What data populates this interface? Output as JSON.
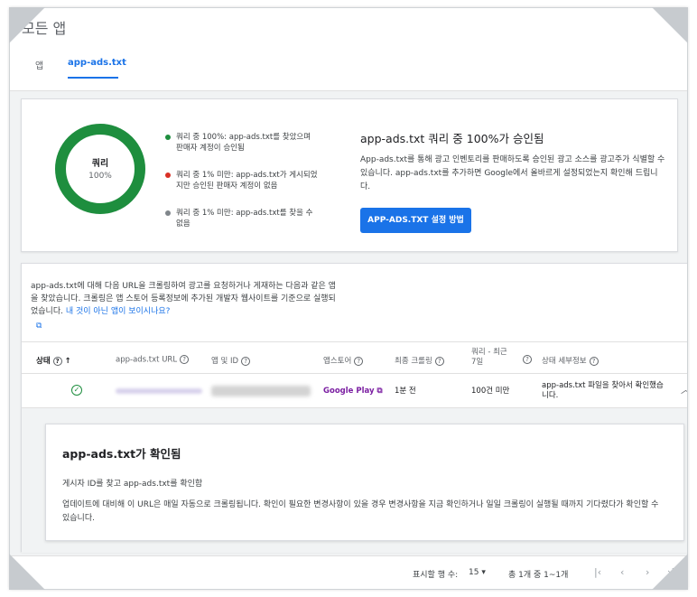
{
  "page": {
    "title": "모든 앱"
  },
  "tabs": [
    {
      "label": "앱",
      "active": false
    },
    {
      "label": "app-ads.txt",
      "active": true
    }
  ],
  "summary": {
    "donut": {
      "title": "쿼리",
      "percent_label": "100%",
      "approved_fraction": 1.0
    },
    "legend": [
      {
        "text": "쿼리 중 100%: app-ads.txt를 찾았으며 판매자 계정이 승인됨",
        "color": "#1e8e3e"
      },
      {
        "text": "쿼리 중 1% 미만: app-ads.txt가 게시되었지만 승인된 판매자 계정이 없음",
        "color": "#d93025"
      },
      {
        "text": "쿼리 중 1% 미만: app-ads.txt를 찾을 수 없음",
        "color": "#80868b"
      }
    ],
    "headline": "app-ads.txt 쿼리 중 100%가 승인됨",
    "description": "App-ads.txt를 통해 광고 인벤토리를 판매하도록 승인된 광고 소스를 광고주가 식별할 수 있습니다. app-ads.txt를 추가하면 Google에서 올바르게 설정되었는지 확인해 드립니다.",
    "button_label": "APP-ADS.TXT 설정 방법"
  },
  "table": {
    "intro_text": "app-ads.txt에 대해 다음 URL을 크롤링하여 광고를 요청하거나 게재하는 다음과 같은 앱을 찾았습니다. 크롤링은 앱 스토어 등록정보에 추가된 개발자 웹사이트를 기준으로 실행되었습니다. ",
    "intro_link": "내 것이 아닌 앱이 보이시나요?",
    "columns": {
      "status": "상태",
      "url": "app-ads.txt URL",
      "app_id": "앱 및 ID",
      "store": "앱스토어",
      "last_crawl": "최종 크롤링",
      "queries_line1": "쿼리 - 최근",
      "queries_line2": "7일",
      "status_detail": "상태 세부정보"
    },
    "rows": [
      {
        "store": "Google Play",
        "last_crawl": "1분 전",
        "queries": "100건 미만",
        "status_detail": "app-ads.txt 파일을 찾아서 확인했습니다."
      }
    ]
  },
  "detail": {
    "title": "app-ads.txt가 확인됨",
    "line1": "게시자 ID를 찾고 app-ads.txt를 확인함",
    "line2": "업데이트에 대비해 이 URL은 매일 자동으로 크롤링됩니다. 확인이 필요한 변경사항이 있을 경우 변경사항을 지금 확인하거나 일일 크롤링이 실행될 때까지 기다렸다가 확인할 수 있습니다."
  },
  "pagination": {
    "rows_label": "표시할 행 수:",
    "rows_value": "15",
    "range": "총 1개 중 1~1개"
  }
}
